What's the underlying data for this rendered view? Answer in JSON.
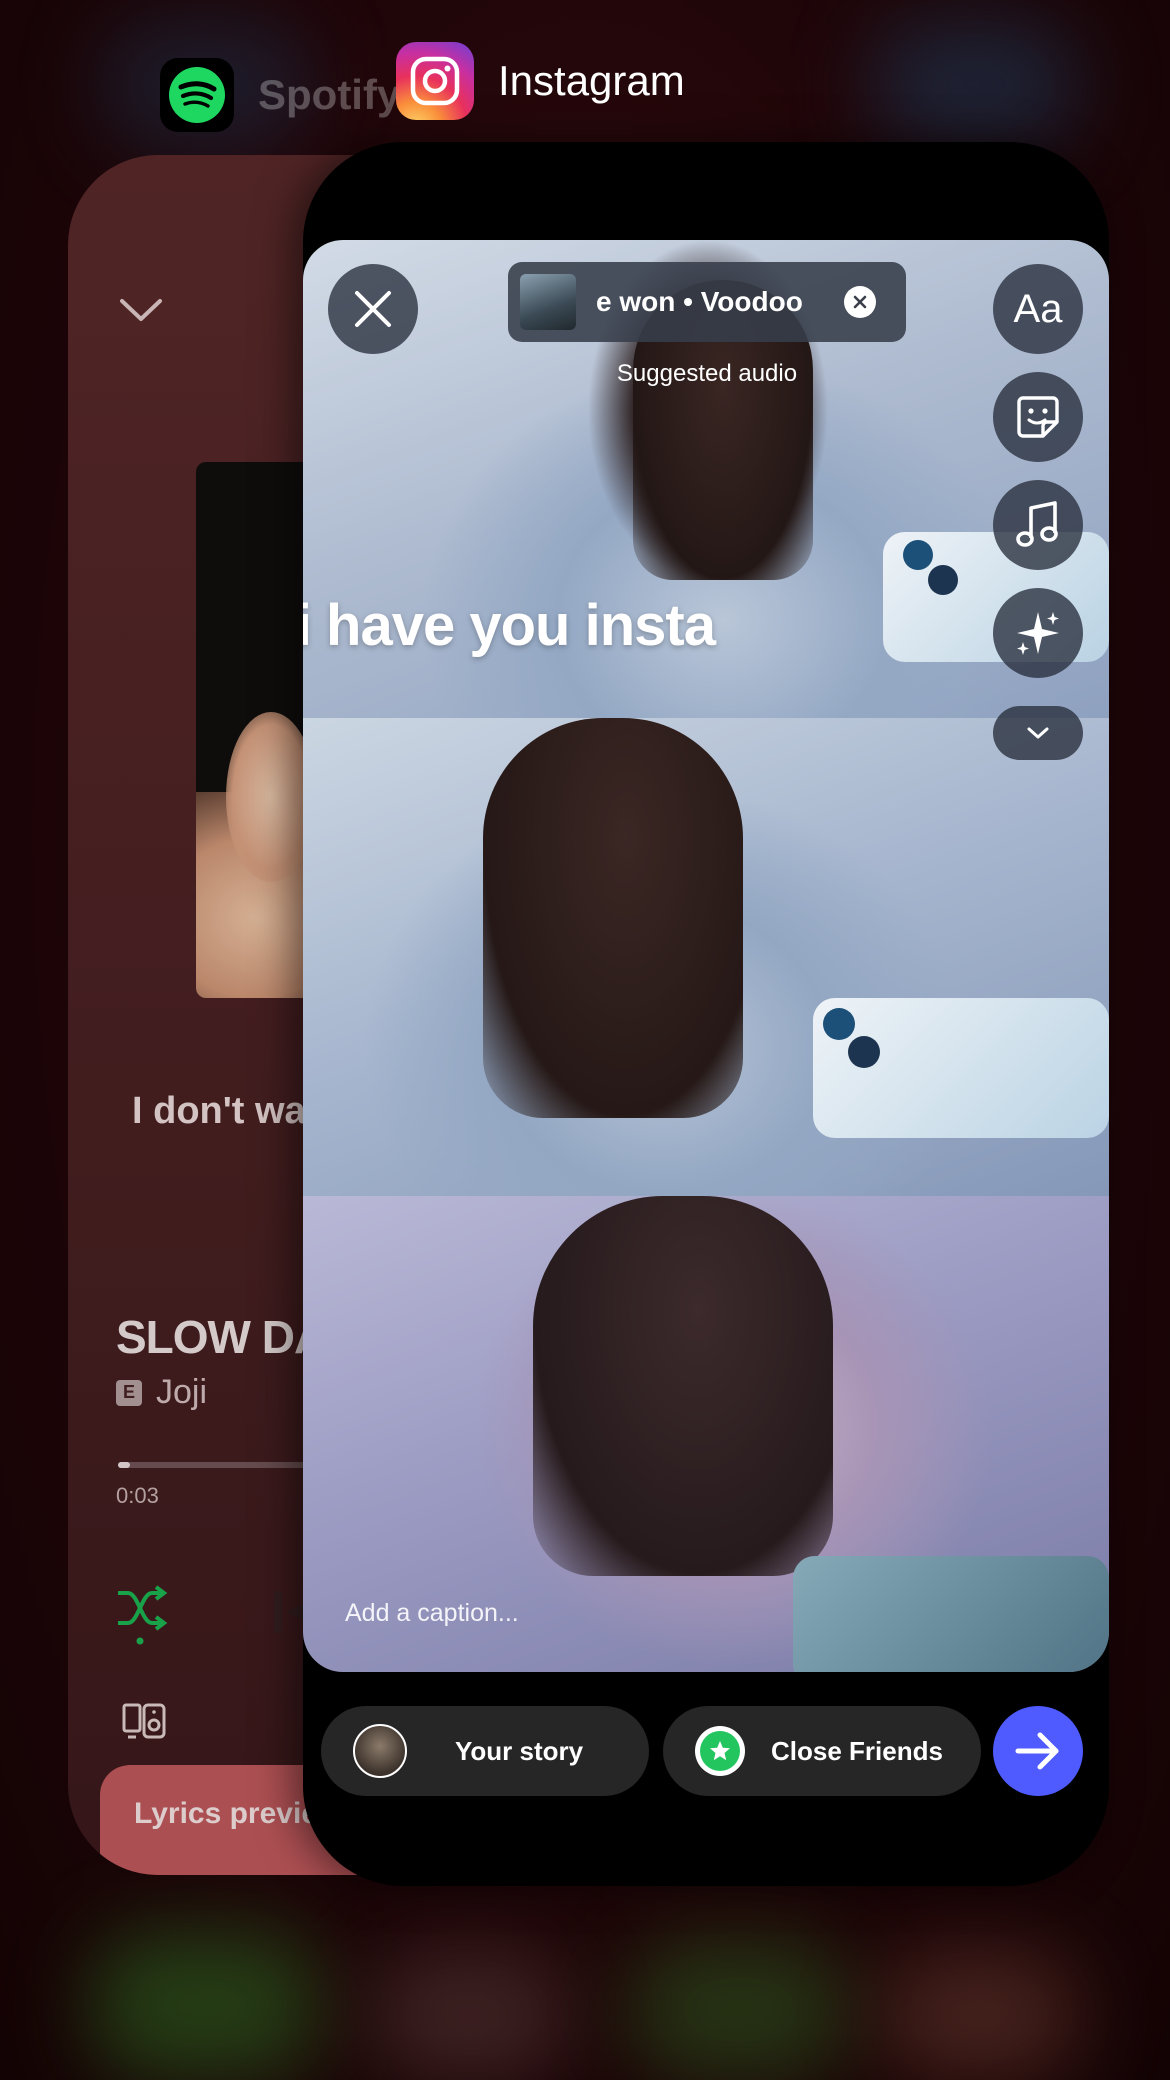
{
  "switcher": {
    "spotify_label": "Spotify",
    "instagram_label": "Instagram"
  },
  "spotify": {
    "lyric_line": "I don't wa",
    "song_title": "SLOW DA",
    "explicit_badge": "E",
    "artist": "Joji",
    "elapsed_time": "0:03",
    "progress_fraction": 0.02,
    "lyrics_preview_label": "Lyrics previe",
    "colors": {
      "accent_green": "#1db954",
      "lyrics_card": "#c45a5e"
    }
  },
  "instagram": {
    "audio_title": "e won • Voodoo",
    "suggested_audio_label": "Suggested audio",
    "overlay_text": "can i have you insta",
    "overlay_emoji": "🗣️",
    "text_tool_label": "Aa",
    "caption_placeholder": "Add a caption...",
    "your_story_label": "Your story",
    "close_friends_label": "Close Friends",
    "colors": {
      "send_button": "#4f5bff",
      "close_friends_badge": "#22c55e"
    }
  },
  "icons": {
    "close": "close-icon",
    "clear_audio": "clear-audio-icon",
    "sticker": "sticker-icon",
    "music": "music-note-icon",
    "effects": "sparkles-icon",
    "more": "chevron-down-icon",
    "send": "arrow-right-icon",
    "collapse": "chevron-down-icon",
    "shuffle": "shuffle-icon",
    "devices": "connect-device-icon"
  }
}
